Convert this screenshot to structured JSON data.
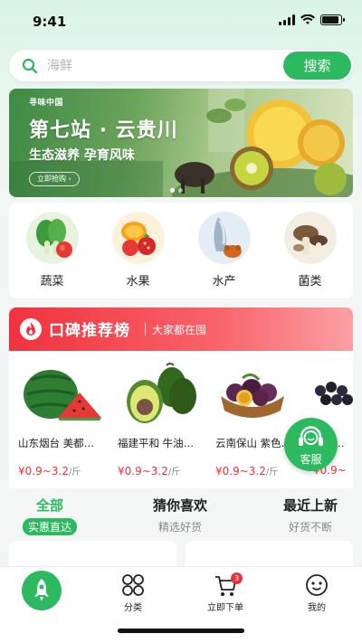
{
  "status_bar": {
    "time": "9:41",
    "battery_level": 0.9
  },
  "search": {
    "placeholder": "海鲜",
    "button_label": "搜索"
  },
  "banner": {
    "brand": "寻味中国",
    "title": "第七站 · 云贵川",
    "subtitle": "生态滋养 孕育风味",
    "cta": "立即抢购 ›",
    "slide_count": 2,
    "active_slide": 1
  },
  "categories": [
    {
      "label": "蔬菜",
      "icon": "vegetables-icon"
    },
    {
      "label": "水果",
      "icon": "fruit-icon"
    },
    {
      "label": "水产",
      "icon": "seafood-icon"
    },
    {
      "label": "菌类",
      "icon": "mushroom-icon"
    }
  ],
  "ranking": {
    "title": "口碑推荐榜",
    "subtitle": "大家都在囤",
    "products": [
      {
        "name": "山东烟台 美都…",
        "price": "¥0.9~3.2",
        "unit": "/斤",
        "image": "watermelon-image"
      },
      {
        "name": "福建平和 牛油…",
        "price": "¥0.9~3.2",
        "unit": "/斤",
        "image": "avocado-image"
      },
      {
        "name": "云南保山 紫色…",
        "price": "¥0.9~3.2",
        "unit": "/斤",
        "image": "passion-fruit-image"
      },
      {
        "name": "黑提…",
        "price": "¥0.9~",
        "unit": "",
        "image": "grape-image"
      }
    ]
  },
  "service": {
    "label": "客服"
  },
  "tabs": [
    {
      "title": "全部",
      "subtitle": "实惠直达",
      "active": true
    },
    {
      "title": "猜你喜欢",
      "subtitle": "精选好货",
      "active": false
    },
    {
      "title": "最近上新",
      "subtitle": "好货不断",
      "active": false
    }
  ],
  "bottom_nav": {
    "items": [
      {
        "label": "",
        "icon": "home-rocket-icon"
      },
      {
        "label": "分类",
        "icon": "category-icon"
      },
      {
        "label": "立即下单",
        "icon": "cart-icon"
      },
      {
        "label": "我的",
        "icon": "profile-icon"
      }
    ],
    "cart_badge": "3"
  },
  "colors": {
    "brand_green": "#2cb960",
    "accent_red": "#e8323c"
  }
}
